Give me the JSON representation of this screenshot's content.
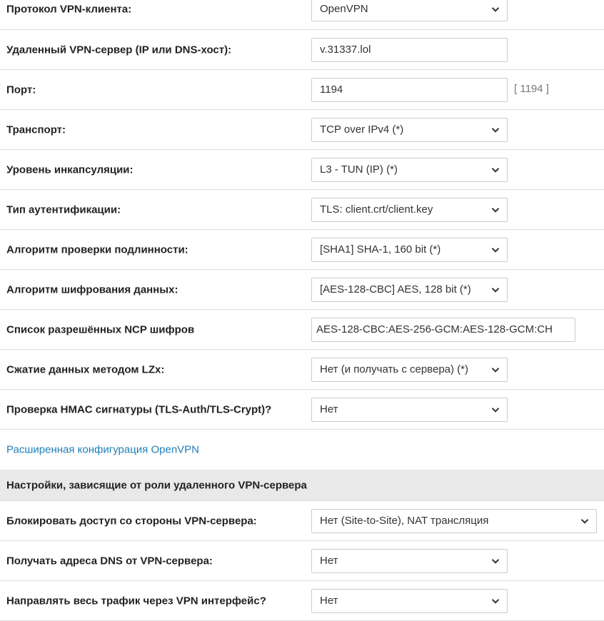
{
  "main_settings": {
    "rows": [
      {
        "label": "Протокол VPN-клиента:",
        "value": "OpenVPN"
      },
      {
        "label": "Удаленный VPN-сервер (IP или DNS-хост):",
        "value": "v.31337.lol"
      },
      {
        "label": "Порт:",
        "value": "1194",
        "hint": "[ 1194 ]"
      },
      {
        "label": "Транспорт:",
        "value": "TCP over IPv4 (*)"
      },
      {
        "label": "Уровень инкапсуляции:",
        "value": "L3 - TUN (IP) (*)"
      },
      {
        "label": "Тип аутентификации:",
        "value": "TLS: client.crt/client.key"
      },
      {
        "label": "Алгоритм проверки подлинности:",
        "value": "[SHA1] SHA-1, 160 bit (*)"
      },
      {
        "label": "Алгоритм шифрования данных:",
        "value": "[AES-128-CBC] AES, 128 bit (*)"
      },
      {
        "label": "Список разрешённых NCP шифров",
        "value": "AES-128-CBC:AES-256-GCM:AES-128-GCM:CH"
      },
      {
        "label": "Сжатие данных методом LZx:",
        "value": "Нет (и получать с сервера) (*)"
      },
      {
        "label": "Проверка HMAC сигнатуры (TLS-Auth/TLS-Crypt)?",
        "value": "Нет"
      }
    ],
    "advanced_link": "Расширенная конфигурация OpenVPN"
  },
  "role_settings": {
    "title": "Настройки, зависящие от роли удаленного VPN-сервера",
    "rows": [
      {
        "label": "Блокировать доступ со стороны VPN-сервера:",
        "value": "Нет (Site-to-Site), NAT трансляция"
      },
      {
        "label": "Получать адреса DNS от VPN-сервера:",
        "value": "Нет"
      },
      {
        "label": "Направлять весь трафик через VPN интерфейс?",
        "value": "Нет"
      }
    ]
  },
  "icons": {
    "dropdown": "chevron-down-icon"
  },
  "colors": {
    "link": "#1f7fb8",
    "section_bg": "#e9e9e9",
    "hint": "#777777"
  }
}
